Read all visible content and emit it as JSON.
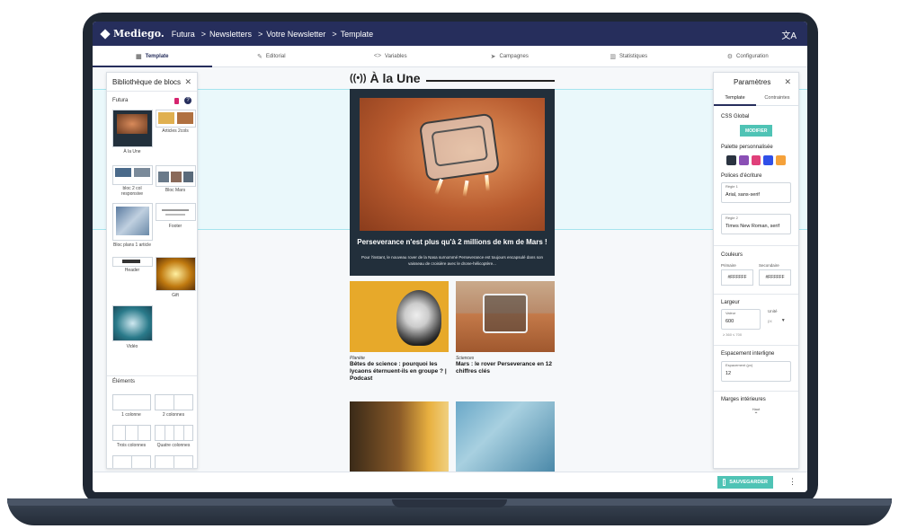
{
  "topbar": {
    "logo": "Mediego.",
    "breadcrumbs": [
      "Futura",
      "Newsletters",
      "Votre Newsletter",
      "Template"
    ],
    "separator": ">"
  },
  "tabs": [
    {
      "label": "Template",
      "icon": "grid-icon",
      "active": true
    },
    {
      "label": "Editorial",
      "icon": "pencil-icon",
      "active": false
    },
    {
      "label": "Variables",
      "icon": "code-icon",
      "active": false
    },
    {
      "label": "Campagnes",
      "icon": "send-icon",
      "active": false
    },
    {
      "label": "Statistiques",
      "icon": "bar-chart-icon",
      "active": false
    },
    {
      "label": "Configuration",
      "icon": "gear-icon",
      "active": false
    }
  ],
  "left_panel": {
    "title": "Bibliothèque de blocs",
    "group": "Futura",
    "blocks": [
      "À la Une",
      "Articles 2cols",
      "bloc 2 col responsive",
      "Bloc Mars",
      "Bloc plans 1 article",
      "Footer",
      "Header",
      "Gift",
      "Vidéo"
    ],
    "elements_title": "Éléments",
    "elements": [
      "1 colonne",
      "2 colonnes",
      "Trois colonnes",
      "Quatre colonnes"
    ]
  },
  "newsletter": {
    "title": "À la Une",
    "hero_heading": "Perseverance n'est plus qu'à 2 millions de km de Mars !",
    "hero_text": "Pour l'instant, le nouveau rover de la Nasa surnommé Perseverance est toujours encapsulé dans son vaisseau de croisière avec le drone-hélicoptère...",
    "cards": [
      {
        "category": "Planète",
        "heading": "Bêtes de science : pourquoi les lycaons éternuent-ils en groupe ? | Podcast"
      },
      {
        "category": "Sciences",
        "heading": "Mars : le rover Perseverance en 12 chiffres clés"
      }
    ]
  },
  "right_panel": {
    "title": "Paramètres",
    "tabs": [
      "Template",
      "Contraintes"
    ],
    "css_global_label": "CSS Global",
    "modifier_label": "MODIFIER",
    "palette_label": "Palette personnalisée",
    "palette": [
      "#2a3340",
      "#8a4fb5",
      "#e0407a",
      "#3050e8",
      "#f5a13a"
    ],
    "fonts_label": "Polices d'écriture",
    "font_rules": [
      {
        "label": "Règle 1",
        "value": "Arial, sans-serif"
      },
      {
        "label": "Règle 2",
        "value": "Times New Roman, serif"
      }
    ],
    "colors_label": "Couleurs",
    "primary_label": "Primaire",
    "primary_value": "#FFFFFF",
    "secondary_label": "Secondaire",
    "secondary_value": "#FFFFFF",
    "width_label": "Largeur",
    "width_value_label": "Valeur",
    "width_value": "600",
    "width_hint": "≥ 360 ≤ 700",
    "width_unit_label": "Unité",
    "width_unit": "px",
    "line_spacing_label": "Espacement interligne",
    "line_spacing_field_label": "Espacement (px)",
    "line_spacing_value": "12",
    "margins_label": "Marges intérieures",
    "margins_top_label": "Haut"
  },
  "footer": {
    "save_label": "SAUVEGARDER"
  },
  "colors": {
    "navy": "#262e5c",
    "teal": "#4fc3b5",
    "highlight": "#eaf8fb"
  }
}
